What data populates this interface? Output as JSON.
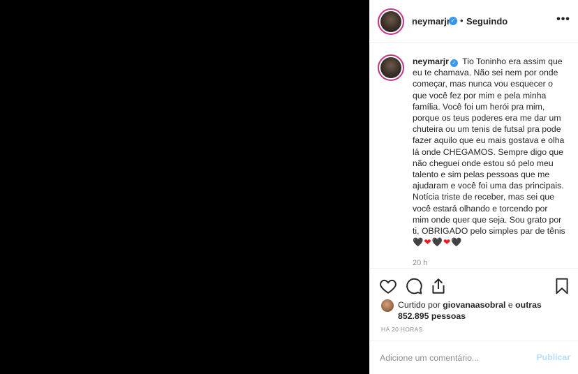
{
  "post": {
    "username": "neymarjr",
    "separator": "•",
    "follow_status": "Seguindo",
    "more_label": "•••",
    "caption": "Tio Toninho era assim que eu te chamava. Não sei nem por onde começar, mas nunca vou esquecer o que você fez por mim e pela minha família. Você foi um herói pra mim, porque os teus poderes era me dar um chuteira ou um tenis de futsal pra pode fazer aquilo que eu mais gostava e olha lá onde CHEGAMOS. Sempre digo que não cheguei onde estou só pelo meu talento e sim pelas pessoas que me ajudaram e você foi uma das principais. Notícia triste de receber, mas sei que você estará olhando e torcendo por mim onde quer que seja. Sou grato por ti, OBRIGADO pelo simples par de tênis",
    "hearts": [
      "🖤",
      "❤",
      "🖤",
      "❤",
      "🖤"
    ],
    "caption_time": "20 h"
  },
  "likes": {
    "prefix": "Curtido por",
    "liker": "giovanaasobral",
    "conjunction": "e",
    "others": "outras 852.895 pessoas"
  },
  "time_ago": "HÁ 20 HORAS",
  "comment": {
    "placeholder": "Adicione um comentário...",
    "post_label": "Publicar"
  },
  "colors": {
    "verified": "#3897f0",
    "heart_red": "#ed1c24",
    "publish_disabled": "#b2dffc",
    "media_bg": "#000000"
  }
}
